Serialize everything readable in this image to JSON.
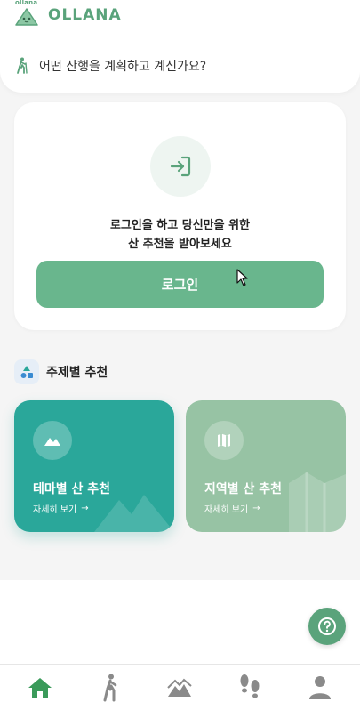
{
  "brand": {
    "small_text": "ollana",
    "name": "OLLANA",
    "color": "#5aa37b"
  },
  "prompt": {
    "icon": "hiker-icon",
    "text": "어떤 산행을 계획하고 계신가요?"
  },
  "login_card": {
    "icon": "login-icon",
    "message_line1": "로그인을 하고 당신만을 위한",
    "message_line2": "산 추천을 받아보세요",
    "button_label": "로그인",
    "button_color": "#69b68d"
  },
  "recommend": {
    "title": "주제별 추천",
    "cards": [
      {
        "title": "테마별 산 추천",
        "link": "자세히 보기",
        "icon": "mountain-icon",
        "color": "#2aa79a"
      },
      {
        "title": "지역별 산 추천",
        "link": "자세히 보기",
        "icon": "map-icon",
        "color": "#97c3a4"
      }
    ]
  },
  "help": {
    "icon": "help-icon"
  },
  "nav": [
    {
      "name": "home",
      "icon": "home-icon",
      "active": true
    },
    {
      "name": "hiking",
      "icon": "walker-icon"
    },
    {
      "name": "mountain",
      "icon": "mountain-trend-icon"
    },
    {
      "name": "footprints",
      "icon": "footprints-icon"
    },
    {
      "name": "profile",
      "icon": "profile-icon"
    }
  ]
}
